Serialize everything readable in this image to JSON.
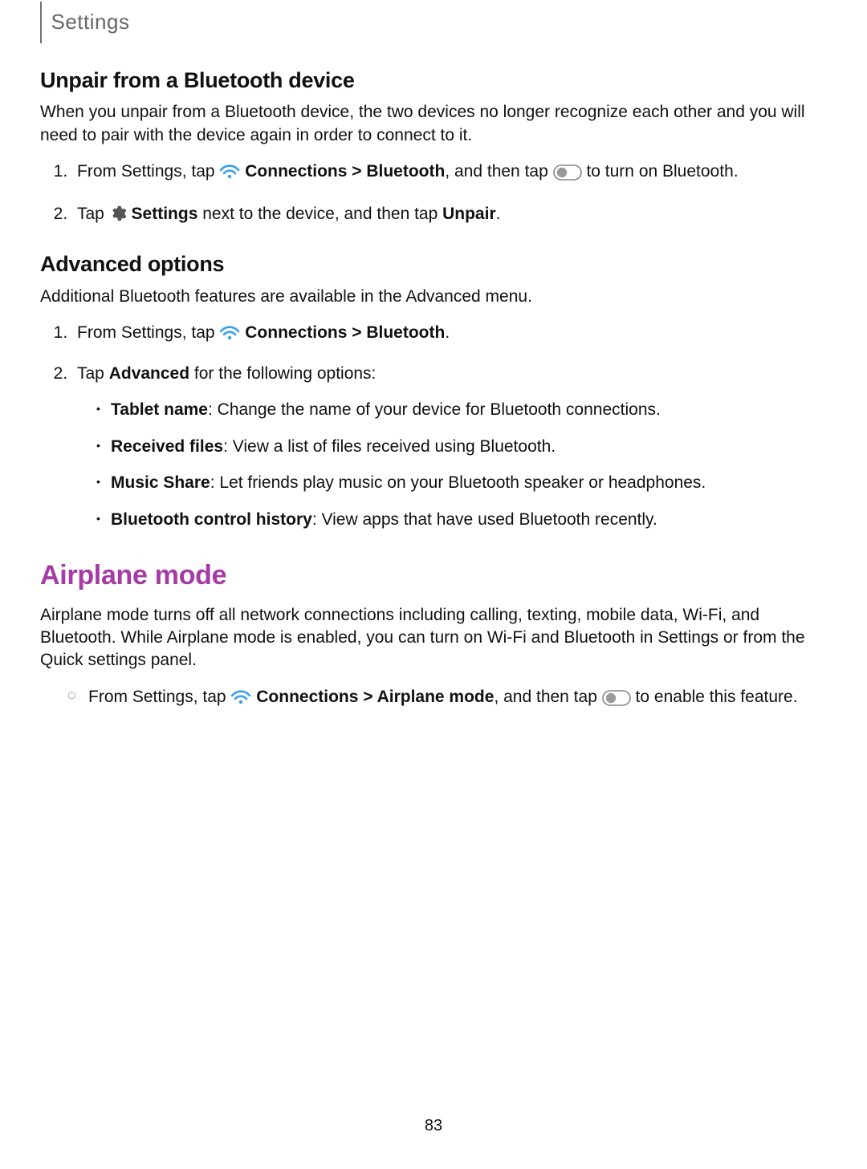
{
  "header": {
    "breadcrumb": "Settings"
  },
  "section_unpair": {
    "title": "Unpair from a Bluetooth device",
    "intro": "When you unpair from a Bluetooth device, the two devices no longer recognize each other and you will need to pair with the device again in order to connect to it.",
    "step1": {
      "a": "From Settings, tap ",
      "b": "Connections > Bluetooth",
      "c": ", and then tap ",
      "d": " to turn on Bluetooth."
    },
    "step2": {
      "a": "Tap ",
      "b": "Settings",
      "c": " next to the device, and then tap ",
      "d": "Unpair",
      "e": "."
    }
  },
  "section_advanced": {
    "title": "Advanced options",
    "intro": "Additional Bluetooth features are available in the Advanced menu.",
    "step1": {
      "a": "From Settings, tap ",
      "b": "Connections > Bluetooth",
      "c": "."
    },
    "step2": {
      "a": "Tap ",
      "b": "Advanced",
      "c": " for the following options:"
    },
    "bullets": [
      {
        "label": "Tablet name",
        "text": ": Change the name of your device for Bluetooth connections."
      },
      {
        "label": "Received files",
        "text": ": View a list of files received using Bluetooth."
      },
      {
        "label": "Music Share",
        "text": ": Let friends play music on your Bluetooth speaker or headphones."
      },
      {
        "label": "Bluetooth control history",
        "text": ": View apps that have used Bluetooth recently."
      }
    ]
  },
  "section_airplane": {
    "title": "Airplane mode",
    "intro": "Airplane mode turns off all network connections including calling, texting, mobile data, Wi-Fi, and Bluetooth. While Airplane mode is enabled, you can turn on Wi-Fi and Bluetooth in Settings or from the Quick settings panel.",
    "step": {
      "a": "From Settings, tap ",
      "b": "Connections > Airplane mode",
      "c": ", and then tap ",
      "d": " to enable this feature."
    }
  },
  "page_number": "83"
}
